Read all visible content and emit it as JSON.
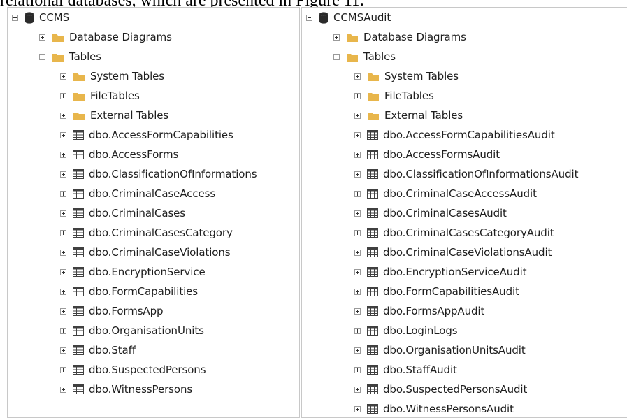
{
  "caption": "relational databases, which are presented in Figure 11.",
  "colors": {
    "folder": "#e8b64c",
    "database": "#2b2b2b",
    "table_grid": "#404040",
    "pane_border": "#c8c8c8"
  },
  "left": {
    "db_name": "CCMS",
    "items": [
      {
        "type": "folder",
        "label": "Database Diagrams"
      },
      {
        "type": "folder",
        "label": "Tables",
        "expanded": true
      },
      {
        "type": "folder",
        "label": "System Tables",
        "child": true
      },
      {
        "type": "folder",
        "label": "FileTables",
        "child": true
      },
      {
        "type": "folder",
        "label": "External Tables",
        "child": true
      },
      {
        "type": "table",
        "label": "dbo.AccessFormCapabilities"
      },
      {
        "type": "table",
        "label": "dbo.AccessForms"
      },
      {
        "type": "table",
        "label": "dbo.ClassificationOfInformations"
      },
      {
        "type": "table",
        "label": "dbo.CriminalCaseAccess"
      },
      {
        "type": "table",
        "label": "dbo.CriminalCases"
      },
      {
        "type": "table",
        "label": "dbo.CriminalCasesCategory"
      },
      {
        "type": "table",
        "label": "dbo.CriminalCaseViolations"
      },
      {
        "type": "table",
        "label": "dbo.EncryptionService"
      },
      {
        "type": "table",
        "label": "dbo.FormCapabilities"
      },
      {
        "type": "table",
        "label": "dbo.FormsApp"
      },
      {
        "type": "table",
        "label": "dbo.OrganisationUnits"
      },
      {
        "type": "table",
        "label": "dbo.Staff"
      },
      {
        "type": "table",
        "label": "dbo.SuspectedPersons"
      },
      {
        "type": "table",
        "label": "dbo.WitnessPersons"
      }
    ]
  },
  "right": {
    "db_name": "CCMSAudit",
    "items": [
      {
        "type": "folder",
        "label": "Database Diagrams"
      },
      {
        "type": "folder",
        "label": "Tables",
        "expanded": true
      },
      {
        "type": "folder",
        "label": "System Tables",
        "child": true
      },
      {
        "type": "folder",
        "label": "FileTables",
        "child": true
      },
      {
        "type": "folder",
        "label": "External Tables",
        "child": true
      },
      {
        "type": "table",
        "label": "dbo.AccessFormCapabilitiesAudit"
      },
      {
        "type": "table",
        "label": "dbo.AccessFormsAudit"
      },
      {
        "type": "table",
        "label": "dbo.ClassificationOfInformationsAudit"
      },
      {
        "type": "table",
        "label": "dbo.CriminalCaseAccessAudit"
      },
      {
        "type": "table",
        "label": "dbo.CriminalCasesAudit"
      },
      {
        "type": "table",
        "label": "dbo.CriminalCasesCategoryAudit"
      },
      {
        "type": "table",
        "label": "dbo.CriminalCaseViolationsAudit"
      },
      {
        "type": "table",
        "label": "dbo.EncryptionServiceAudit"
      },
      {
        "type": "table",
        "label": "dbo.FormCapabilitiesAudit"
      },
      {
        "type": "table",
        "label": "dbo.FormsAppAudit"
      },
      {
        "type": "table",
        "label": "dbo.LoginLogs"
      },
      {
        "type": "table",
        "label": "dbo.OrganisationUnitsAudit"
      },
      {
        "type": "table",
        "label": "dbo.StaffAudit"
      },
      {
        "type": "table",
        "label": "dbo.SuspectedPersonsAudit"
      },
      {
        "type": "table",
        "label": "dbo.WitnessPersonsAudit"
      }
    ]
  }
}
